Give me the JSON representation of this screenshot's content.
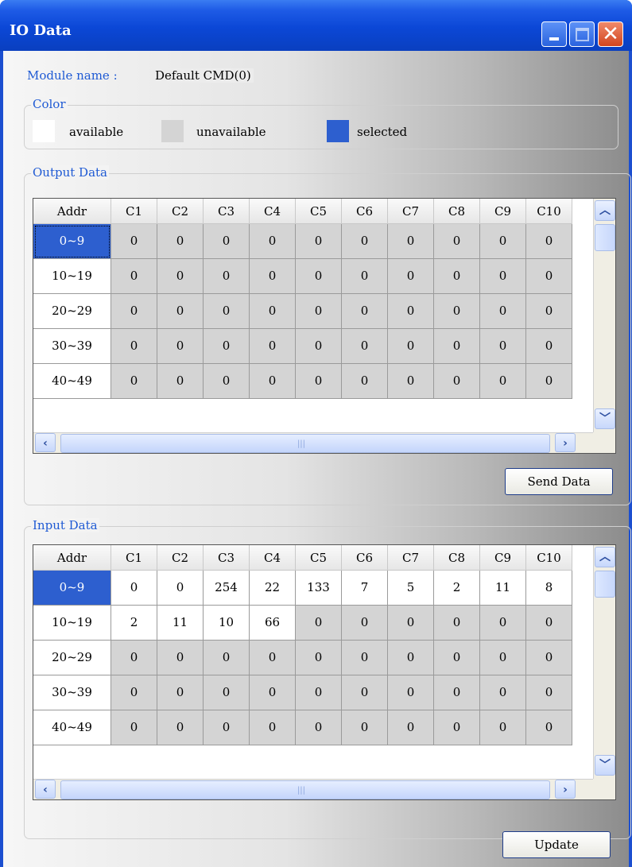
{
  "window": {
    "title": "IO Data"
  },
  "module": {
    "label": "Module name :",
    "value": "Default CMD(0)"
  },
  "color_legend": {
    "title": "Color",
    "available": "available",
    "unavailable": "unavailable",
    "selected": "selected",
    "colors": {
      "available": "#ffffff",
      "unavailable": "#d4d4d4",
      "selected": "#2d5fcf"
    }
  },
  "output": {
    "title": "Output Data",
    "headers": [
      "Addr",
      "C1",
      "C2",
      "C3",
      "C4",
      "C5",
      "C6",
      "C7",
      "C8",
      "C9",
      "C10"
    ],
    "rows": [
      {
        "addr": "0~9",
        "values": [
          "0",
          "0",
          "0",
          "0",
          "0",
          "0",
          "0",
          "0",
          "0",
          "0"
        ]
      },
      {
        "addr": "10~19",
        "values": [
          "0",
          "0",
          "0",
          "0",
          "0",
          "0",
          "0",
          "0",
          "0",
          "0"
        ]
      },
      {
        "addr": "20~29",
        "values": [
          "0",
          "0",
          "0",
          "0",
          "0",
          "0",
          "0",
          "0",
          "0",
          "0"
        ]
      },
      {
        "addr": "30~39",
        "values": [
          "0",
          "0",
          "0",
          "0",
          "0",
          "0",
          "0",
          "0",
          "0",
          "0"
        ]
      },
      {
        "addr": "40~49",
        "values": [
          "0",
          "0",
          "0",
          "0",
          "0",
          "0",
          "0",
          "0",
          "0",
          "0"
        ]
      }
    ],
    "button": "Send Data"
  },
  "input": {
    "title": "Input Data",
    "headers": [
      "Addr",
      "C1",
      "C2",
      "C3",
      "C4",
      "C5",
      "C6",
      "C7",
      "C8",
      "C9",
      "C10"
    ],
    "rows": [
      {
        "addr": "0~9",
        "values": [
          "0",
          "0",
          "254",
          "22",
          "133",
          "7",
          "5",
          "2",
          "11",
          "8"
        ]
      },
      {
        "addr": "10~19",
        "values": [
          "2",
          "11",
          "10",
          "66",
          "0",
          "0",
          "0",
          "0",
          "0",
          "0"
        ]
      },
      {
        "addr": "20~29",
        "values": [
          "0",
          "0",
          "0",
          "0",
          "0",
          "0",
          "0",
          "0",
          "0",
          "0"
        ]
      },
      {
        "addr": "30~39",
        "values": [
          "0",
          "0",
          "0",
          "0",
          "0",
          "0",
          "0",
          "0",
          "0",
          "0"
        ]
      },
      {
        "addr": "40~49",
        "values": [
          "0",
          "0",
          "0",
          "0",
          "0",
          "0",
          "0",
          "0",
          "0",
          "0"
        ]
      }
    ],
    "button": "Update"
  }
}
